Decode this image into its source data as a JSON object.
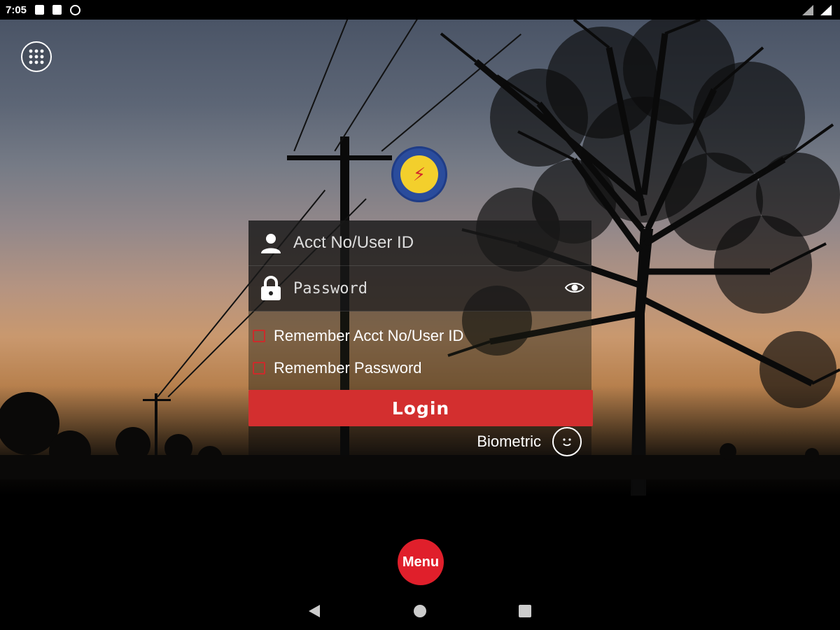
{
  "status_bar": {
    "time": "7:05",
    "icons": [
      "notification-icon",
      "sd-card-icon",
      "sync-icon"
    ],
    "right_icons": [
      "wifi-icon",
      "signal-icon"
    ]
  },
  "grid_button": {
    "icon": "apps-grid-icon"
  },
  "logo": {
    "icon": "cooperative-logo"
  },
  "login_form": {
    "user_field": {
      "placeholder": "Acct No/User ID",
      "value": "",
      "icon": "user-icon"
    },
    "password_field": {
      "placeholder": "Password",
      "value": "",
      "icon": "lock-icon",
      "toggle_icon": "eye-icon"
    },
    "remember_user_label": "Remember Acct No/User ID",
    "remember_password_label": "Remember Password",
    "login_label": "Login",
    "biometric_label": "Biometric",
    "biometric_icon": "face-icon"
  },
  "menu_button": {
    "label": "Menu"
  },
  "nav_bar": {
    "icons": [
      "back-icon",
      "home-icon",
      "recents-icon"
    ]
  },
  "colors": {
    "accent": "#d32f2f",
    "menu": "#e01f2b",
    "checkbox": "#cc2b2b"
  }
}
